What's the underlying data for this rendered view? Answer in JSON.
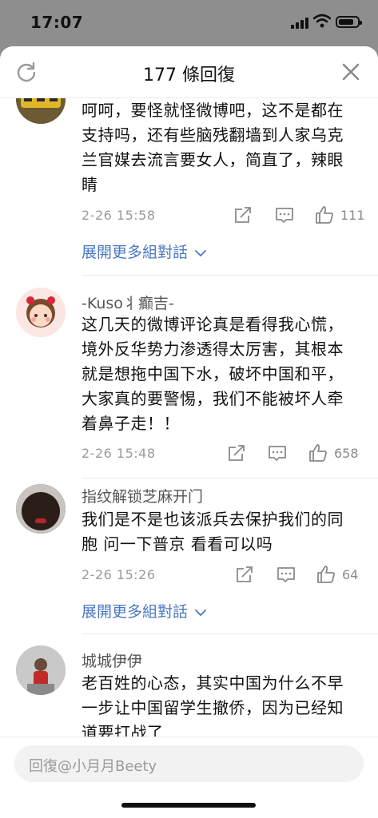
{
  "status": {
    "time": "17:07"
  },
  "header": {
    "title": "177 條回復"
  },
  "comments": [
    {
      "text": "呵呵，要怪就怪微博吧，这不是都在支持吗，还有些脑残翻墙到人家乌克兰官媒去流言要女人，简直了，辣眼睛",
      "date": "2-26 15:58",
      "likes": "111",
      "expand": "展開更多組對話"
    },
    {
      "username": "-Kuso丬癫吉-",
      "text": "这几天的微博评论真是看得我心慌，境外反华势力渗透得太厉害，其根本就是想拖中国下水，破坏中国和平，大家真的要警惕，我们不能被坏人牵着鼻子走！！",
      "date": "2-26 15:48",
      "likes": "658"
    },
    {
      "username": "指纹解锁芝麻开门",
      "text": "我们是不是也该派兵去保护我们的同胞 问一下普京 看看可以吗",
      "date": "2-26 15:26",
      "likes": "64",
      "expand": "展開更多組對話"
    },
    {
      "username": "城城伊伊",
      "text": "老百姓的心态，其实中国为什么不早一步让中国留学生撤侨，因为已经知道要打战了"
    }
  ],
  "footer": {
    "reply_placeholder": "回復@小月月Beety"
  },
  "icons": [
    "refresh-icon",
    "close-icon",
    "share-icon",
    "comment-icon",
    "like-icon"
  ]
}
